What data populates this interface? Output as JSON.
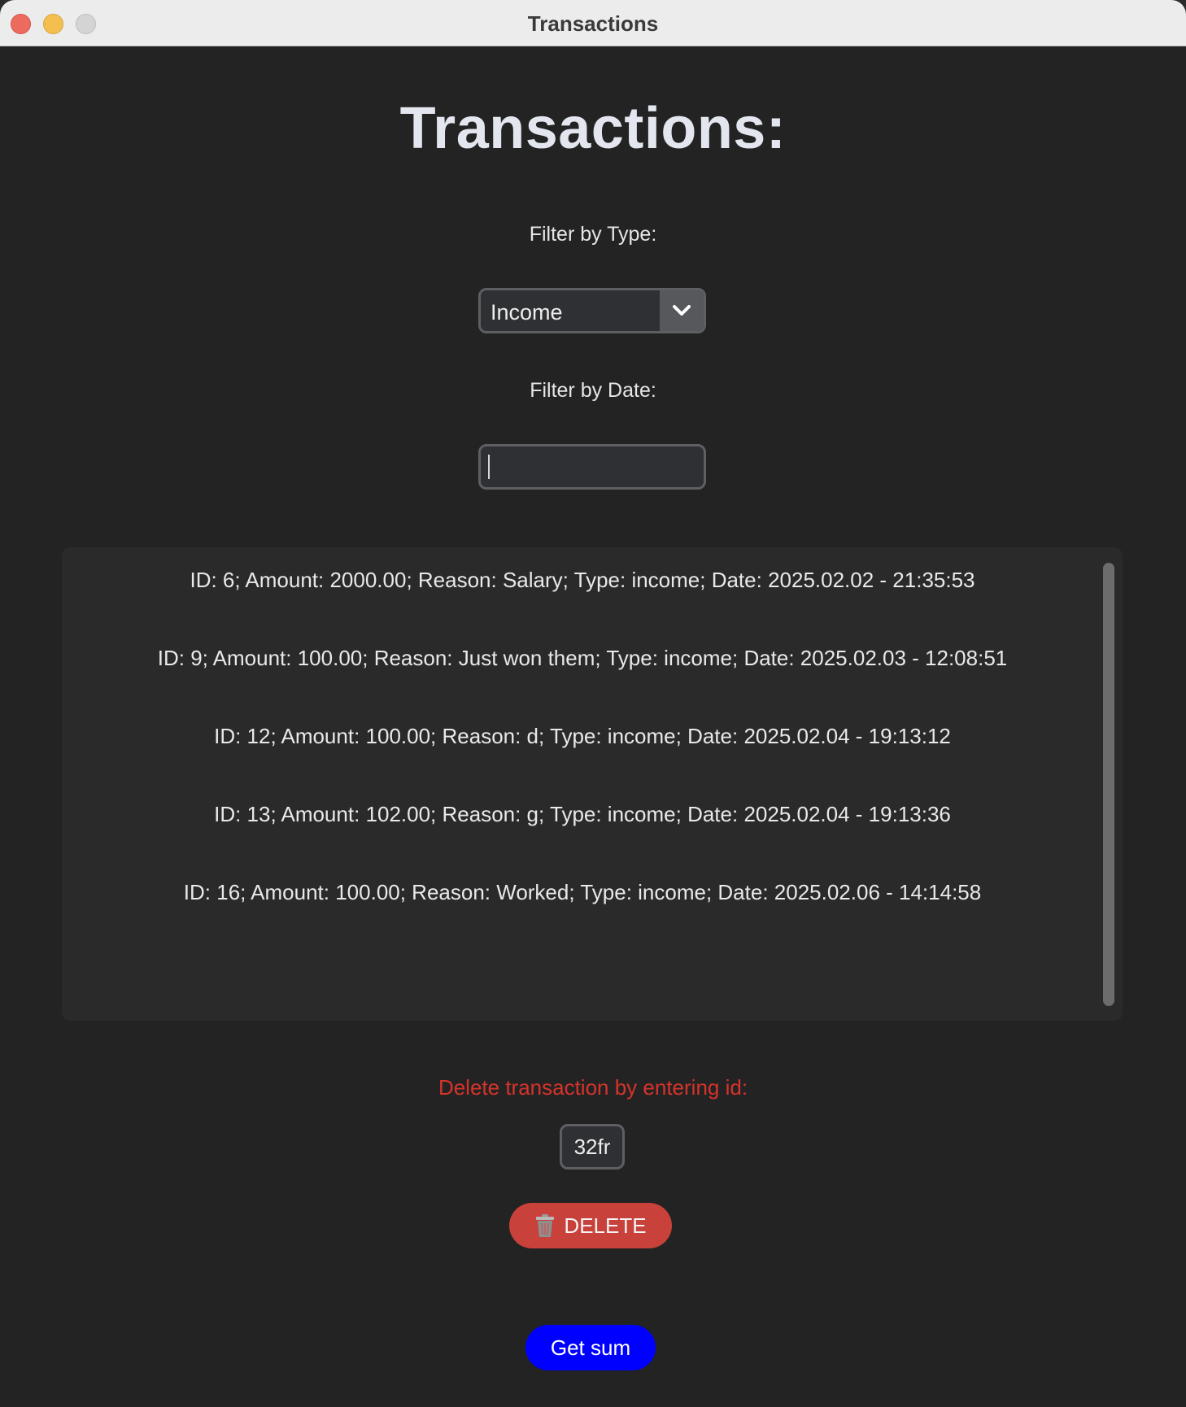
{
  "window": {
    "title": "Transactions"
  },
  "page": {
    "heading": "Transactions:"
  },
  "filters": {
    "type_label": "Filter by Type:",
    "type_selected": "Income",
    "date_label": "Filter by Date:",
    "date_value": ""
  },
  "transactions": [
    "ID: 6; Amount: 2000.00; Reason: Salary; Type: income; Date: 2025.02.02 - 21:35:53",
    "ID: 9; Amount: 100.00; Reason: Just won them; Type: income; Date: 2025.02.03 - 12:08:51",
    "ID: 12; Amount: 100.00; Reason: d; Type: income; Date: 2025.02.04 - 19:13:12",
    "ID: 13; Amount: 102.00; Reason: g; Type: income; Date: 2025.02.04 - 19:13:36",
    "ID: 16; Amount: 100.00; Reason: Worked; Type: income; Date: 2025.02.06 - 14:14:58"
  ],
  "delete": {
    "label": "Delete transaction by entering id:",
    "id_value": "32fr",
    "button_label": "DELETE",
    "button_icon": "trash-icon"
  },
  "sum": {
    "button_label": "Get sum"
  },
  "colors": {
    "background": "#232323",
    "delete_label": "#d6332c",
    "delete_button": "#c8413a",
    "sum_button": "#0000ff"
  }
}
